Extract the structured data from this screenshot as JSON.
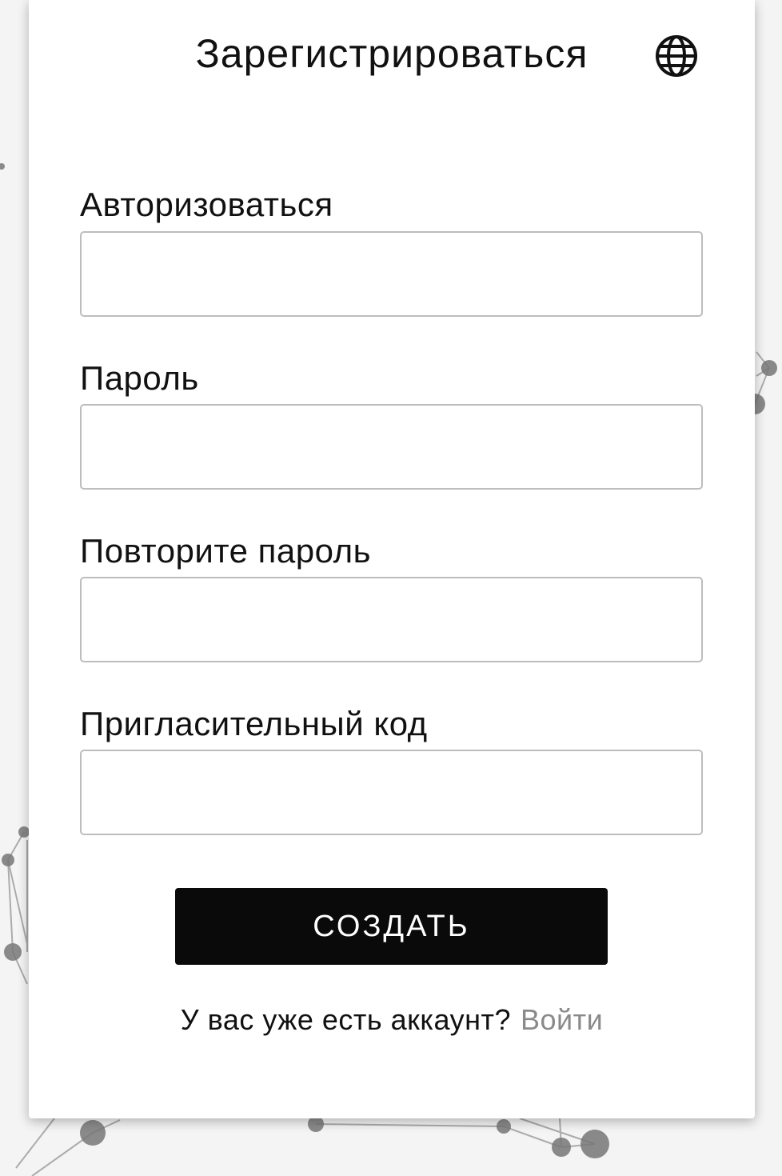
{
  "header": {
    "title": "Зарегистрироваться",
    "language_icon": "globe-icon"
  },
  "form": {
    "fields": [
      {
        "label": "Авторизоваться",
        "value": "",
        "placeholder": ""
      },
      {
        "label": "Пароль",
        "value": "",
        "placeholder": ""
      },
      {
        "label": "Повторите пароль",
        "value": "",
        "placeholder": ""
      },
      {
        "label": "Пригласительный код",
        "value": "",
        "placeholder": ""
      }
    ],
    "submit_label": "СОЗДАТЬ"
  },
  "footer": {
    "question": "У вас уже есть аккаунт?",
    "login_link": "Войти"
  },
  "colors": {
    "button_bg": "#0a0a0a",
    "link": "#8a8a8a",
    "input_border": "#bdbdbd"
  }
}
